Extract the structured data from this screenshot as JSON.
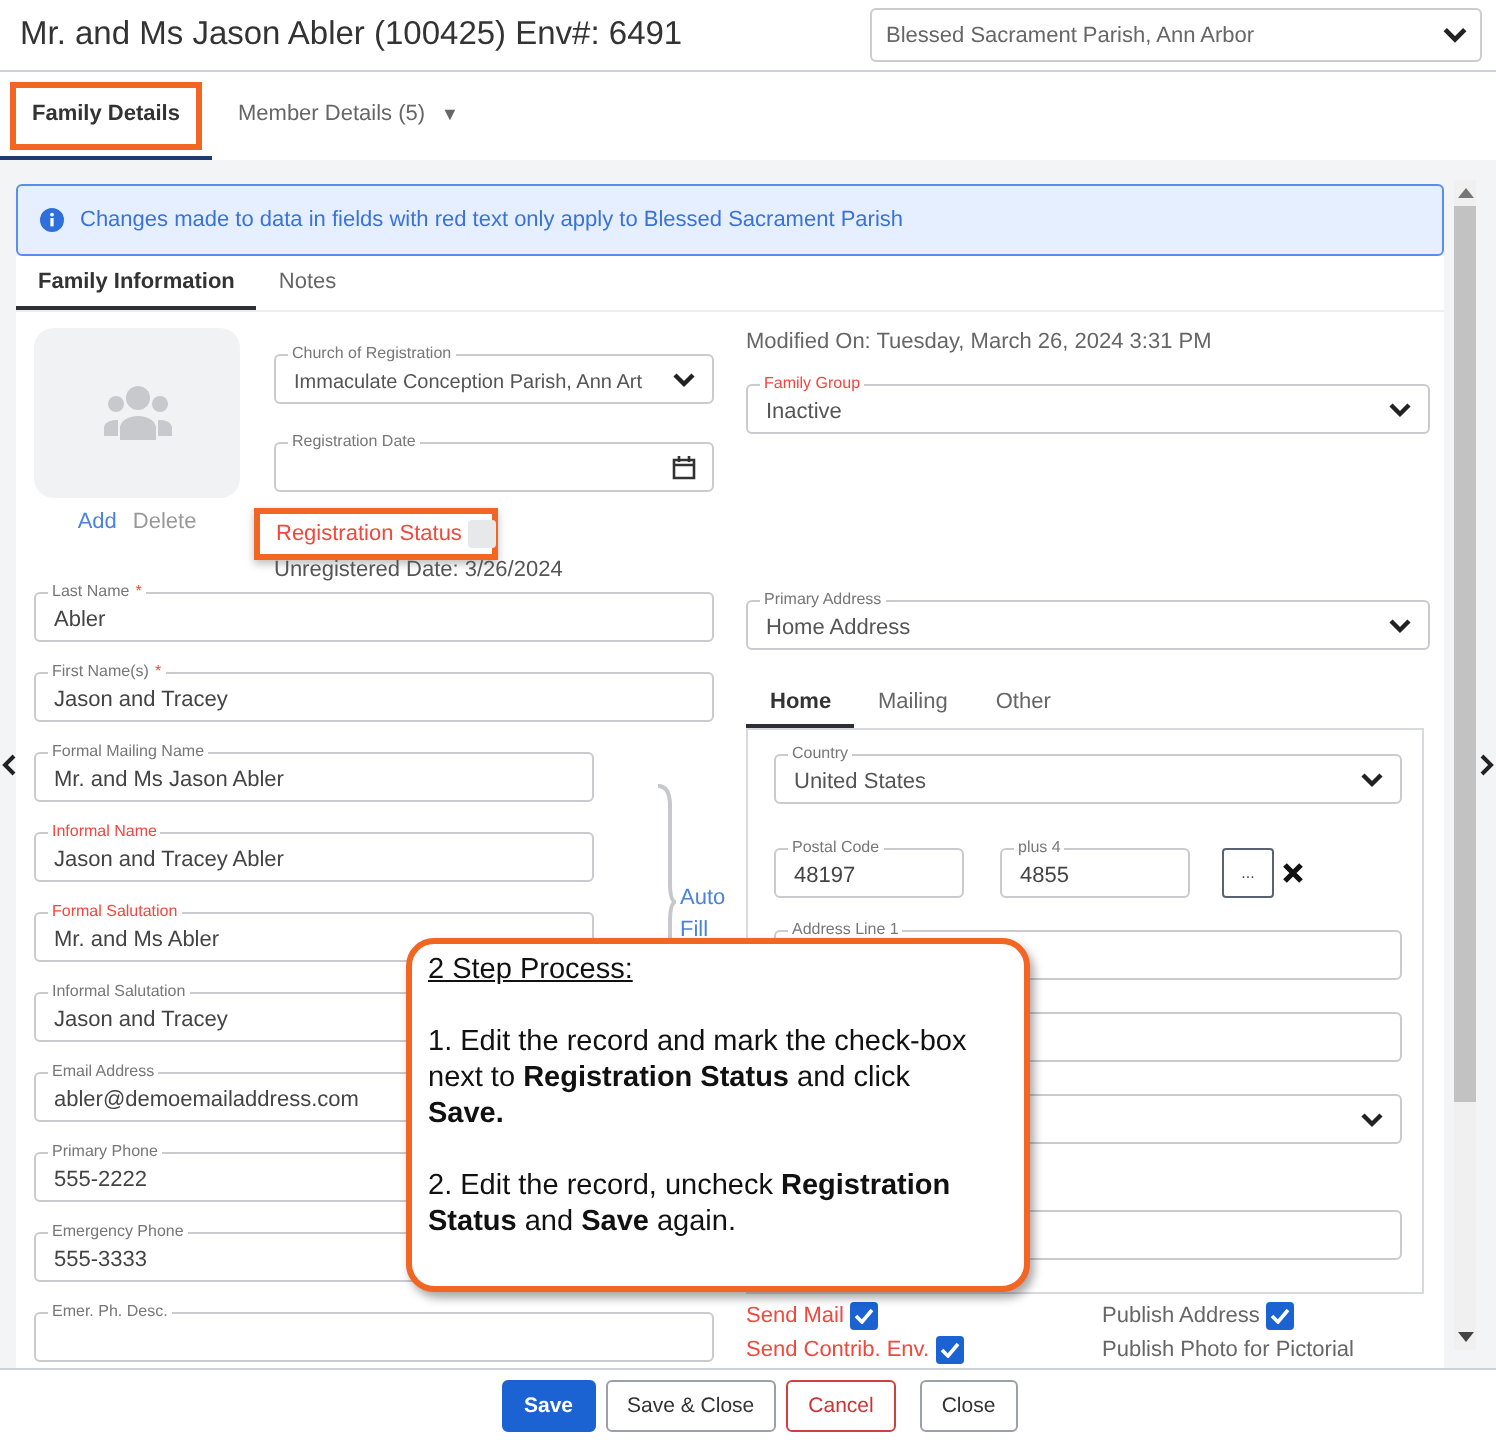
{
  "header": {
    "title": "Mr. and Ms Jason Abler (100425) Env#: 6491",
    "parish_select": "Blessed Sacrament Parish, Ann Arbor"
  },
  "tabs": [
    {
      "label": "Family Details",
      "selected": true,
      "highlighted": true
    },
    {
      "label": "Member Details (5)",
      "selected": false,
      "highlighted": false,
      "menu": "▼"
    }
  ],
  "alert": "Changes made to data in fields with red text only apply to Blessed Sacrament Parish",
  "sub_tabs": [
    {
      "label": "Family Information",
      "selected": true
    },
    {
      "label": "Notes",
      "selected": false
    }
  ],
  "photo_actions": [
    {
      "label": "Add",
      "enabled": true
    },
    {
      "label": "Delete",
      "enabled": false
    }
  ],
  "church_fields": [
    {
      "kind": "select",
      "label": "Church of Registration",
      "value": "Immaculate Conception Parish, Ann Art",
      "red_label": false
    },
    {
      "kind": "date",
      "label": "Registration Date",
      "red_label": false
    }
  ],
  "registration_status": {
    "label": "Registration Status",
    "checked": false,
    "highlighted": true,
    "note": "Unregistered Date: 3/26/2024"
  },
  "name_fields": [
    {
      "kind": "text",
      "label": "Last Name",
      "required_mark": "*",
      "value": "Abler",
      "red_label": false
    },
    {
      "kind": "text",
      "label": "First Name(s)",
      "required_mark": "*",
      "value": "Jason and Tracey",
      "red_label": false
    }
  ],
  "auto_fill_fields": [
    {
      "kind": "text",
      "label": "Formal Mailing Name",
      "value": "Mr. and Ms Jason Abler",
      "red_label": false
    },
    {
      "kind": "text",
      "label": "Informal Name",
      "value": "Jason and Tracey Abler",
      "red_label": true
    },
    {
      "kind": "text",
      "label": "Formal Salutation",
      "value": "Mr. and Ms Abler",
      "red_label": true
    },
    {
      "kind": "text",
      "label": "Informal Salutation",
      "value": "Jason and Tracey",
      "red_label": false
    }
  ],
  "auto_fill_link": "Auto Fill",
  "contact_fields": [
    {
      "kind": "text",
      "label": "Email Address",
      "value": "abler@demoemailaddress.com",
      "red_label": false
    },
    {
      "kind": "text",
      "label": "Primary Phone",
      "value": "555-2222",
      "red_label": false
    },
    {
      "kind": "text",
      "label": "Emergency Phone",
      "value": "555-3333",
      "red_label": false
    },
    {
      "kind": "text",
      "label": "Emer. Ph. Desc.",
      "red_label": false
    }
  ],
  "modified_on": "Modified On: Tuesday, March 26, 2024 3:31 PM",
  "family_group": {
    "kind": "select",
    "label": "Family Group",
    "value": "Inactive",
    "red_label": true
  },
  "primary_address": {
    "kind": "select",
    "label": "Primary Address",
    "value": "Home Address",
    "red_label": false
  },
  "address_tabs": [
    {
      "label": "Home",
      "selected": true
    },
    {
      "label": "Mailing",
      "selected": false
    },
    {
      "label": "Other",
      "selected": false
    }
  ],
  "address": {
    "country": {
      "kind": "select",
      "label": "Country",
      "value": "United States",
      "red_label": false
    },
    "postal_code": {
      "kind": "text",
      "label": "Postal Code",
      "value": "48197",
      "red_label": false
    },
    "plus4": {
      "kind": "text",
      "label": "plus 4",
      "value": "4855",
      "red_label": false
    },
    "lookup_button": "...",
    "rows": [
      {
        "kind": "text",
        "label": "Address Line 1",
        "red_label": false
      },
      {
        "kind": "text"
      },
      {
        "kind": "select"
      },
      {
        "kind": "text"
      }
    ]
  },
  "options": [
    {
      "label": "Send Mail",
      "checked": true,
      "red_label": true
    },
    {
      "label": "Publish Address",
      "checked": true,
      "red_label": false
    },
    {
      "label": "Send Contrib. Env.",
      "checked": true,
      "red_label": true
    },
    {
      "label": "Publish Photo for Pictorial",
      "red_label": false
    }
  ],
  "callout": {
    "title": "2 Step Process:",
    "steps": [
      "1. Edit the record and mark the check-box next to **Registration Status** and click **Save.**",
      "2. Edit the record, uncheck **Registration Status** and **Save** again."
    ]
  },
  "buttons": [
    {
      "label": "Save",
      "kind": "primary"
    },
    {
      "label": "Save & Close",
      "kind": "secondary"
    },
    {
      "label": "Cancel",
      "kind": "danger"
    },
    {
      "label": "Close",
      "kind": "secondary"
    }
  ]
}
